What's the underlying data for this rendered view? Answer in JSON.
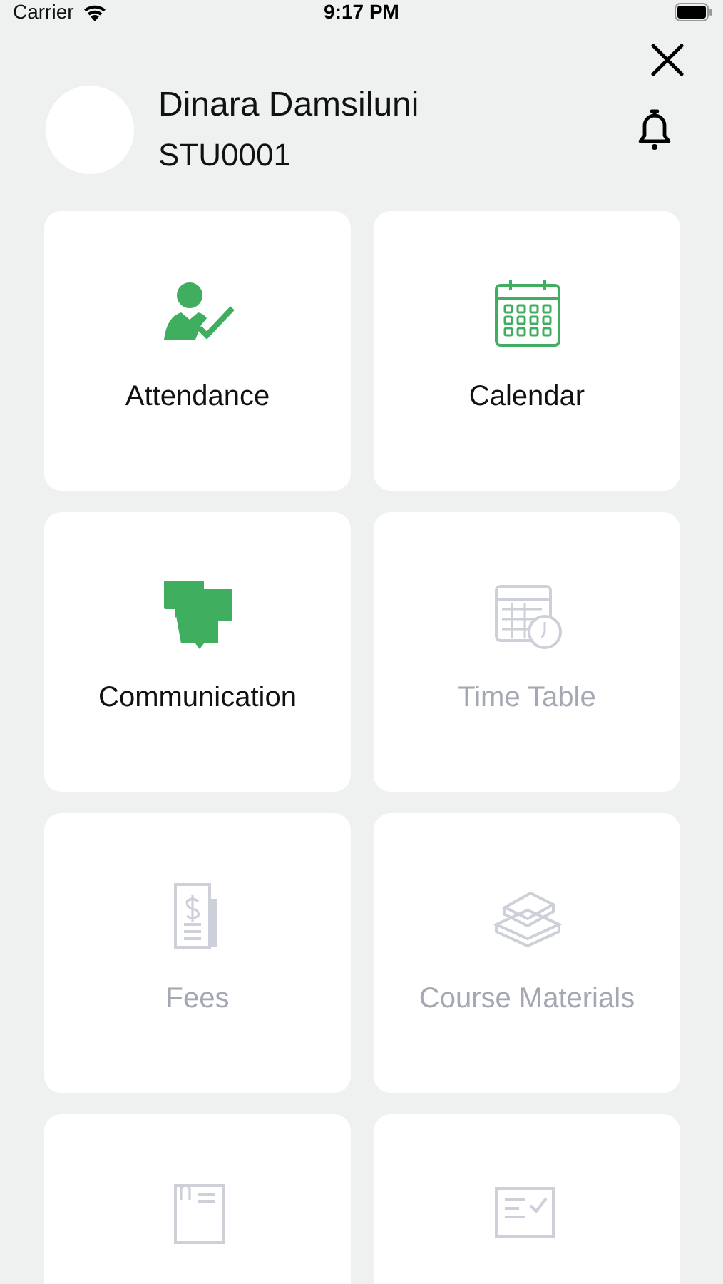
{
  "status_bar": {
    "carrier": "Carrier",
    "time": "9:17 PM"
  },
  "profile": {
    "name": "Dinara Damsiluni",
    "id": "STU0001"
  },
  "tiles": [
    {
      "kind": "attendance",
      "label": "Attendance",
      "disabled": false
    },
    {
      "kind": "calendar",
      "label": "Calendar",
      "disabled": false
    },
    {
      "kind": "communication",
      "label": "Communication",
      "disabled": false
    },
    {
      "kind": "timetable",
      "label": "Time Table",
      "disabled": true
    },
    {
      "kind": "fees",
      "label": "Fees",
      "disabled": true
    },
    {
      "kind": "materials",
      "label": "Course Materials",
      "disabled": true
    },
    {
      "kind": "document",
      "disabled": true
    },
    {
      "kind": "checklist",
      "disabled": true
    }
  ]
}
